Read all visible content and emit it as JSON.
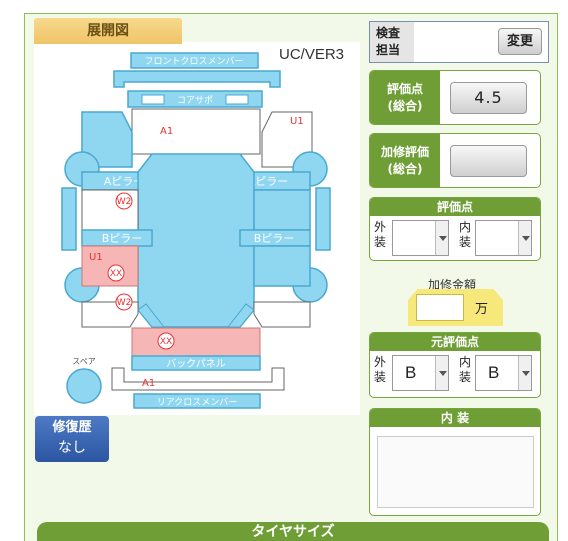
{
  "diagram": {
    "tab_title": "展開図",
    "version": "UC/VER3",
    "parts": {
      "front_cross_member": "フロントクロスメンバー",
      "core_support": "コアサポ",
      "a_pillar_left": "Aピラー",
      "a_pillar_right": "Aピラー",
      "b_pillar_left": "Bピラー",
      "b_pillar_right": "Bピラー",
      "back_panel": "バックパネル",
      "rear_cross_member": "リアクロスメンバー",
      "spare": "スペア"
    },
    "marks": {
      "a1_top": "A1",
      "u1_right": "U1",
      "w2_upper": "W2",
      "u1_left": "U1",
      "xx_left": "XX",
      "w2_lower": "W2",
      "xx_back": "XX",
      "a1_bottom": "A1"
    }
  },
  "inspector": {
    "label": "検査\n担当",
    "change_label": "変更"
  },
  "score_total": {
    "label": "評価点\n(総合)",
    "value": "4.5"
  },
  "repair_score": {
    "label": "加修評価\n(総合)",
    "value": ""
  },
  "score": {
    "header": "評価点",
    "exterior_label": "外\n装",
    "interior_label": "内\n装",
    "exterior_value": "",
    "interior_value": ""
  },
  "repair_cost": {
    "label": "加修金額",
    "value": "",
    "unit": "万"
  },
  "original_score": {
    "header": "元評価点",
    "exterior_label": "外\n装",
    "interior_label": "内\n装",
    "exterior_value": "B",
    "interior_value": "B"
  },
  "interior": {
    "header": "内 装",
    "text": ""
  },
  "repair_history": {
    "title": "修復歴",
    "value": "なし"
  },
  "tire": {
    "header": "タイヤサイズ"
  },
  "colors": {
    "accent_green": "#6e9e35",
    "part_blue": "#8fd6f0",
    "damage_pink": "#f6b6b6",
    "repair_blue": "#2c56a2"
  }
}
